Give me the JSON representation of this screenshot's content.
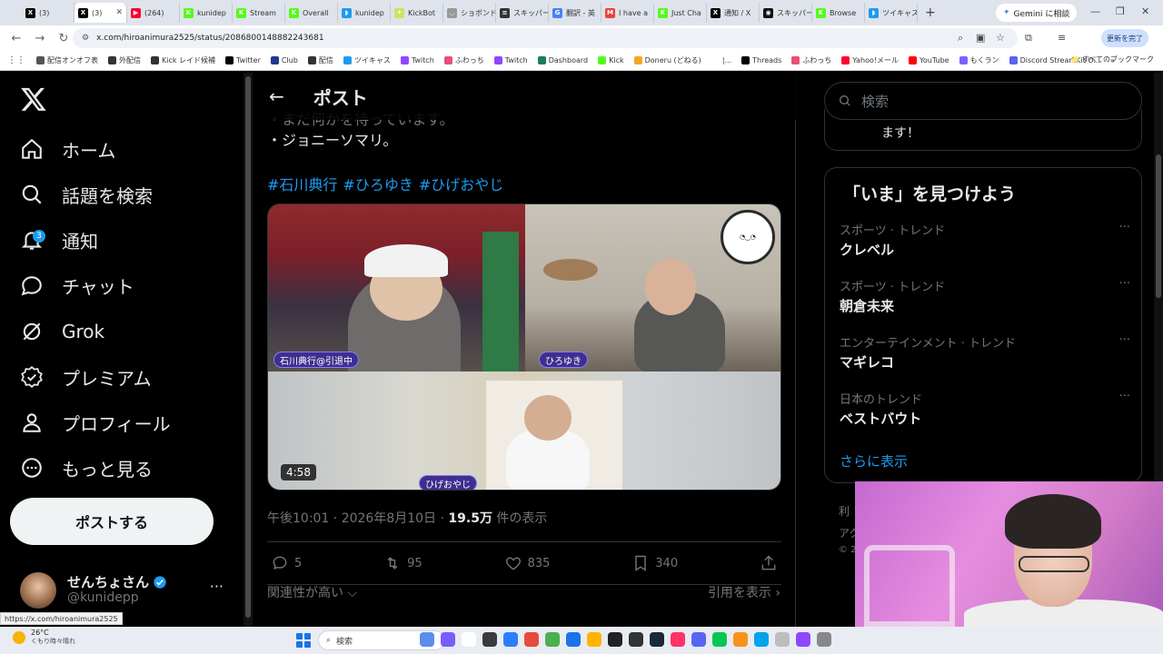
{
  "browser": {
    "tabs": [
      {
        "label": "(3)",
        "color": "#000000",
        "glyph": "X"
      },
      {
        "label": "(3)",
        "color": "#000000",
        "glyph": "X",
        "active": true
      },
      {
        "label": "(264) ",
        "color": "#ff0033",
        "glyph": "▶"
      },
      {
        "label": "kunidep",
        "color": "#53fc18",
        "glyph": "K"
      },
      {
        "label": "Stream",
        "color": "#53fc18",
        "glyph": "K"
      },
      {
        "label": "Overall",
        "color": "#53fc18",
        "glyph": "K"
      },
      {
        "label": "kunidep",
        "color": "#1d9bf0",
        "glyph": "◗"
      },
      {
        "label": "KickBot",
        "color": "#cde35c",
        "glyph": "✦"
      },
      {
        "label": "ショボンド",
        "color": "#999999",
        "glyph": "◡"
      },
      {
        "label": "スキッパー",
        "color": "#333333",
        "glyph": "≡"
      },
      {
        "label": "翻訳 - 英",
        "color": "#4285f4",
        "glyph": "G"
      },
      {
        "label": "I have a",
        "color": "#ea4335",
        "glyph": "M"
      },
      {
        "label": "Just Cha",
        "color": "#53fc18",
        "glyph": "K"
      },
      {
        "label": "通知 / X",
        "color": "#000000",
        "glyph": "X"
      },
      {
        "label": "スキッパー",
        "color": "#111111",
        "glyph": "◉"
      },
      {
        "label": "Browse",
        "color": "#53fc18",
        "glyph": "K"
      },
      {
        "label": "ツイキャス",
        "color": "#1d9bf0",
        "glyph": "◗"
      }
    ],
    "new_tab": "+",
    "gemini_label": "Gemini に相談",
    "url": "x.com/hiroanimura2525/status/2086800148882243681",
    "update_label": "更新を完了",
    "bookmarks": [
      {
        "label": "配信オンオフ表",
        "color": "#555555"
      },
      {
        "label": "外配信",
        "color": "#333333"
      },
      {
        "label": "Kick レイド候補",
        "color": "#333333"
      },
      {
        "label": "Twitter",
        "color": "#000000"
      },
      {
        "label": "Club",
        "color": "#1f3a93"
      },
      {
        "label": "配信",
        "color": "#333333"
      },
      {
        "label": "ツイキャス",
        "color": "#1d9bf0"
      },
      {
        "label": "Twitch",
        "color": "#9146ff"
      },
      {
        "label": "ふわっち",
        "color": "#e94e77"
      },
      {
        "label": "Twitch",
        "color": "#9146ff"
      },
      {
        "label": "Dashboard",
        "color": "#1a7f5a"
      },
      {
        "label": "Kick",
        "color": "#53fc18"
      },
      {
        "label": "Doneru (どねる)",
        "color": "#f5a623"
      },
      {
        "label": "|...",
        "color": "#ffffff"
      },
      {
        "label": "Threads",
        "color": "#000000"
      },
      {
        "label": "ふわっち",
        "color": "#e94e77"
      },
      {
        "label": "Yahoo!メール",
        "color": "#ff0033"
      },
      {
        "label": "YouTube",
        "color": "#ff0000"
      },
      {
        "label": "もくラン",
        "color": "#7b61ff"
      },
      {
        "label": "Discord StreamKit O...",
        "color": "#5865f2"
      }
    ],
    "bookmarks_more": "»",
    "all_bookmarks": "すべてのブックマーク",
    "status_url": "https://x.com/hiroanimura2525"
  },
  "nav": {
    "items": [
      {
        "label": "ホーム",
        "icon": "home-icon"
      },
      {
        "label": "話題を検索",
        "icon": "search-icon"
      },
      {
        "label": "通知",
        "icon": "bell-icon",
        "badge": "3"
      },
      {
        "label": "チャット",
        "icon": "chat-icon"
      },
      {
        "label": "Grok",
        "icon": "grok-icon"
      },
      {
        "label": "プレミアム",
        "icon": "verified-icon"
      },
      {
        "label": "プロフィール",
        "icon": "person-icon"
      },
      {
        "label": "もっと見る",
        "icon": "more-circle-icon"
      }
    ],
    "post_button": "ポストする",
    "account": {
      "name": "せんちょさん",
      "handle": "@kunidepp",
      "more": "···"
    }
  },
  "post": {
    "header_title": "ポスト",
    "body_partial": "・まだ何かを待っています。",
    "body_line": "・ジョニーソマリ。",
    "hashtags": [
      "#石川典行",
      "#ひろゆき",
      "#ひげおやじ"
    ],
    "video": {
      "duration": "4:58",
      "labels": [
        "石川典行@引退中",
        "ひろゆき",
        "ひげおやじ"
      ]
    },
    "time": "午後10:01 · 2026年8月10日 · ",
    "views": "19.5万",
    "views_label": " 件の表示",
    "actions": {
      "replies": "5",
      "reposts": "95",
      "likes": "835",
      "bookmarks": "340"
    },
    "sort_label": "関連性が高い",
    "quote_label": "引用を表示"
  },
  "sidebar": {
    "search_placeholder": "検索",
    "top_card_tail": "ます！",
    "trends_title": "「いま」を見つけよう",
    "trends": [
      {
        "context": "スポーツ · トレンド",
        "name": "クレベル"
      },
      {
        "context": "スポーツ · トレンド",
        "name": "朝倉未来"
      },
      {
        "context": "エンターテインメント · トレンド",
        "name": "マギレコ"
      },
      {
        "context": "日本のトレンド",
        "name": "ベストバウト"
      }
    ],
    "trend_more": "···",
    "show_more": "さらに表示",
    "footer_frags": [
      "利",
      "アク",
      "© 2"
    ]
  },
  "taskbar": {
    "temp": "26°C",
    "weather": "くもり時々晴れ",
    "search_placeholder": "検索"
  },
  "colors": {
    "accent": "#1d9bf0",
    "bg": "#000000",
    "muted": "#71767b",
    "text": "#e7e9ea"
  }
}
